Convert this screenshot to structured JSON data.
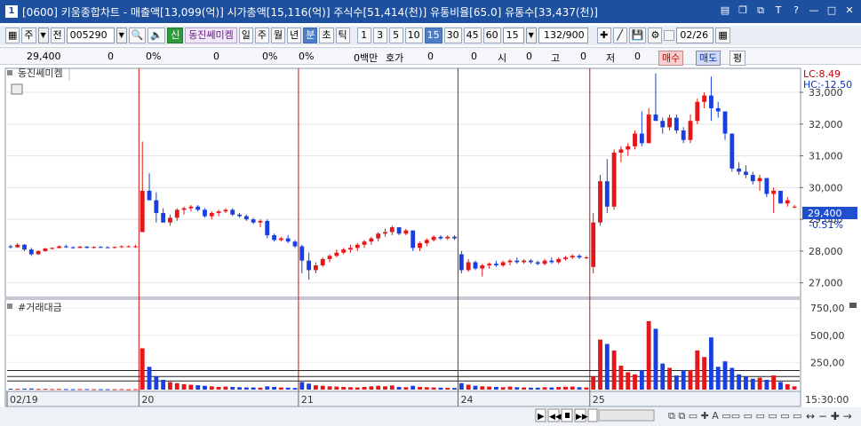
{
  "window": {
    "num": "1",
    "title": "[0600] 키움종합차트 - 매출액[13,099(억)] 시가총액[15,116(억)] 주식수[51,414(천)] 유통비율[65.0] 유통수[33,437(천)]"
  },
  "toolbar": {
    "market": "주",
    "prev": "전",
    "code": "005290",
    "shin": "신",
    "stock_name": "동진쎄미켐",
    "periods": [
      "일",
      "주",
      "월",
      "년",
      "분",
      "초",
      "틱"
    ],
    "selected_period": "분",
    "intervals": [
      "1",
      "3",
      "5",
      "10",
      "15",
      "30",
      "45",
      "60"
    ],
    "selected_interval": "15",
    "interval_value": "15",
    "bars": "132/900",
    "date": "02/26"
  },
  "quote": {
    "price": "29,400",
    "c1": "0",
    "c2": "0%",
    "c3": "0",
    "c4": "0%",
    "c5": "0%",
    "c6": "0백만",
    "hoga_label": "호가",
    "hoga1": "0",
    "hoga2": "0",
    "si_label": "시",
    "si": "0",
    "go_label": "고",
    "go": "0",
    "jeo_label": "저",
    "jeo": "0",
    "buy": "매수",
    "sell": "매도",
    "avg": "평"
  },
  "chart": {
    "price_label": "동진쎄미켐",
    "lc": "LC:8.49",
    "hc": "HC:-12.50",
    "current_price": "29,400",
    "current_change": "-0.51%",
    "volume_label": "#거래대금",
    "time_label": "15:30:00",
    "date_labels": [
      "02/19",
      "20",
      "21",
      "24",
      "25"
    ]
  },
  "chart_data": {
    "type": "candlestick",
    "y_ticks": [
      27000,
      28000,
      29000,
      30000,
      31000,
      32000,
      33000
    ],
    "y_tick_labels": [
      "27,000",
      "28,000",
      "29,000",
      "30,000",
      "31,000",
      "32,000",
      "33,000"
    ],
    "ylim": [
      26600,
      33700
    ],
    "volume_ticks": [
      250,
      500,
      750
    ],
    "volume_tick_labels": [
      "250,00",
      "500,00",
      "750,00"
    ],
    "volume_ylim": [
      0,
      800
    ],
    "candles": [
      [
        28150,
        28200,
        28080,
        28120,
        8
      ],
      [
        28120,
        28250,
        28100,
        28200,
        7
      ],
      [
        28200,
        28220,
        28000,
        28050,
        9
      ],
      [
        28050,
        28100,
        27850,
        27900,
        10
      ],
      [
        27900,
        28020,
        27880,
        28000,
        6
      ],
      [
        28000,
        28100,
        27980,
        28080,
        7
      ],
      [
        28080,
        28120,
        28050,
        28100,
        5
      ],
      [
        28100,
        28180,
        28080,
        28150,
        6
      ],
      [
        28150,
        28200,
        28100,
        28120,
        5
      ],
      [
        28120,
        28150,
        28080,
        28100,
        4
      ],
      [
        28100,
        28160,
        28090,
        28140,
        5
      ],
      [
        28140,
        28160,
        28090,
        28100,
        5
      ],
      [
        28100,
        28150,
        28080,
        28130,
        4
      ],
      [
        28130,
        28160,
        28100,
        28120,
        4
      ],
      [
        28120,
        28150,
        28090,
        28100,
        4
      ],
      [
        28100,
        28140,
        28080,
        28130,
        4
      ],
      [
        28130,
        28180,
        28100,
        28150,
        5
      ],
      [
        28150,
        28180,
        28120,
        28150,
        3
      ],
      [
        28150,
        28200,
        28100,
        28150,
        4
      ],
      [
        28600,
        31450,
        28600,
        29900,
        380
      ],
      [
        29900,
        30450,
        29700,
        29600,
        210
      ],
      [
        29600,
        29850,
        28900,
        29200,
        120
      ],
      [
        29200,
        29350,
        28900,
        28900,
        90
      ],
      [
        28900,
        29150,
        28800,
        29050,
        70
      ],
      [
        29050,
        29350,
        28950,
        29300,
        60
      ],
      [
        29300,
        29400,
        29150,
        29350,
        50
      ],
      [
        29350,
        29450,
        29250,
        29400,
        45
      ],
      [
        29400,
        29450,
        29250,
        29300,
        40
      ],
      [
        29300,
        29350,
        29050,
        29100,
        35
      ],
      [
        29100,
        29250,
        29000,
        29200,
        30
      ],
      [
        29200,
        29300,
        29100,
        29250,
        25
      ],
      [
        29250,
        29350,
        29200,
        29300,
        28
      ],
      [
        29300,
        29350,
        29100,
        29150,
        25
      ],
      [
        29150,
        29200,
        29050,
        29100,
        22
      ],
      [
        29100,
        29150,
        28950,
        29000,
        20
      ],
      [
        29000,
        29050,
        28850,
        28900,
        20
      ],
      [
        28900,
        29000,
        28750,
        28950,
        18
      ],
      [
        28950,
        29000,
        28400,
        28500,
        30
      ],
      [
        28500,
        28550,
        28300,
        28350,
        25
      ],
      [
        28350,
        28450,
        28300,
        28400,
        20
      ],
      [
        28400,
        28500,
        28250,
        28300,
        18
      ],
      [
        28300,
        28350,
        28100,
        28150,
        15
      ],
      [
        28150,
        28200,
        27300,
        27700,
        70
      ],
      [
        27700,
        27950,
        27100,
        27400,
        55
      ],
      [
        27400,
        27650,
        27300,
        27550,
        40
      ],
      [
        27550,
        27800,
        27500,
        27750,
        35
      ],
      [
        27750,
        27900,
        27650,
        27850,
        30
      ],
      [
        27850,
        28050,
        27800,
        27950,
        28
      ],
      [
        27950,
        28100,
        27900,
        28050,
        25
      ],
      [
        28050,
        28200,
        27950,
        28100,
        22
      ],
      [
        28100,
        28250,
        28000,
        28200,
        20
      ],
      [
        28200,
        28350,
        28100,
        28300,
        25
      ],
      [
        28300,
        28450,
        28200,
        28400,
        30
      ],
      [
        28400,
        28600,
        28300,
        28550,
        35
      ],
      [
        28550,
        28700,
        28450,
        28600,
        30
      ],
      [
        28600,
        28800,
        28500,
        28750,
        38
      ],
      [
        28750,
        28750,
        28500,
        28550,
        25
      ],
      [
        28550,
        28700,
        28500,
        28650,
        22
      ],
      [
        28650,
        28650,
        28000,
        28100,
        35
      ],
      [
        28100,
        28300,
        28000,
        28250,
        25
      ],
      [
        28250,
        28400,
        28150,
        28350,
        22
      ],
      [
        28350,
        28500,
        28300,
        28450,
        20
      ],
      [
        28450,
        28500,
        28350,
        28400,
        18
      ],
      [
        28400,
        28500,
        28350,
        28450,
        16
      ],
      [
        28450,
        28500,
        28350,
        28400,
        15
      ],
      [
        27900,
        28000,
        27300,
        27400,
        60
      ],
      [
        27400,
        27750,
        27350,
        27650,
        45
      ],
      [
        27650,
        27700,
        27400,
        27450,
        35
      ],
      [
        27450,
        27600,
        27200,
        27550,
        30
      ],
      [
        27550,
        27650,
        27450,
        27600,
        28
      ],
      [
        27600,
        27700,
        27500,
        27550,
        25
      ],
      [
        27550,
        27700,
        27500,
        27650,
        22
      ],
      [
        27650,
        27750,
        27550,
        27700,
        28
      ],
      [
        27700,
        27800,
        27600,
        27650,
        22
      ],
      [
        27650,
        27750,
        27600,
        27700,
        20
      ],
      [
        27700,
        27750,
        27600,
        27650,
        18
      ],
      [
        27650,
        27700,
        27550,
        27600,
        18
      ],
      [
        27600,
        27750,
        27550,
        27700,
        22
      ],
      [
        27700,
        27800,
        27600,
        27650,
        20
      ],
      [
        27650,
        27800,
        27600,
        27750,
        24
      ],
      [
        27750,
        27850,
        27700,
        27800,
        26
      ],
      [
        27800,
        27900,
        27750,
        27850,
        28
      ],
      [
        27850,
        27900,
        27750,
        27800,
        22
      ],
      [
        27800,
        27850,
        27750,
        27800,
        20
      ],
      [
        27500,
        29200,
        27300,
        28900,
        120
      ],
      [
        28900,
        30400,
        28800,
        30200,
        460
      ],
      [
        30200,
        30900,
        29200,
        29400,
        420
      ],
      [
        29400,
        31200,
        29300,
        31100,
        360
      ],
      [
        31100,
        31300,
        30800,
        31200,
        220
      ],
      [
        31200,
        31400,
        31000,
        31300,
        160
      ],
      [
        31300,
        31800,
        31200,
        31700,
        140
      ],
      [
        31700,
        32400,
        31300,
        31400,
        180
      ],
      [
        31400,
        32500,
        31400,
        32300,
        630
      ],
      [
        32300,
        33600,
        32300,
        32100,
        560
      ],
      [
        32100,
        32200,
        31700,
        31900,
        240
      ],
      [
        31900,
        32300,
        31800,
        32200,
        200
      ],
      [
        32200,
        32300,
        31700,
        31800,
        130
      ],
      [
        31800,
        31900,
        31400,
        31500,
        180
      ],
      [
        31500,
        32300,
        31400,
        32100,
        180
      ],
      [
        32100,
        32800,
        32000,
        32700,
        360
      ],
      [
        32700,
        33000,
        32500,
        32900,
        300
      ],
      [
        32900,
        33500,
        32100,
        32500,
        480
      ],
      [
        32500,
        32700,
        32200,
        32400,
        210
      ],
      [
        32400,
        32400,
        31500,
        31700,
        260
      ],
      [
        31700,
        31700,
        30500,
        30600,
        200
      ],
      [
        30600,
        30800,
        30400,
        30500,
        140
      ],
      [
        30500,
        30700,
        30300,
        30400,
        120
      ],
      [
        30400,
        30500,
        30100,
        30200,
        100
      ],
      [
        30200,
        30400,
        29900,
        30300,
        110
      ],
      [
        30300,
        30300,
        29700,
        29800,
        90
      ],
      [
        29800,
        30000,
        29200,
        29900,
        130
      ],
      [
        29900,
        29900,
        29500,
        29500,
        70
      ],
      [
        29500,
        29700,
        29400,
        29600,
        50
      ],
      [
        29400,
        29450,
        29350,
        29400,
        30
      ]
    ]
  }
}
